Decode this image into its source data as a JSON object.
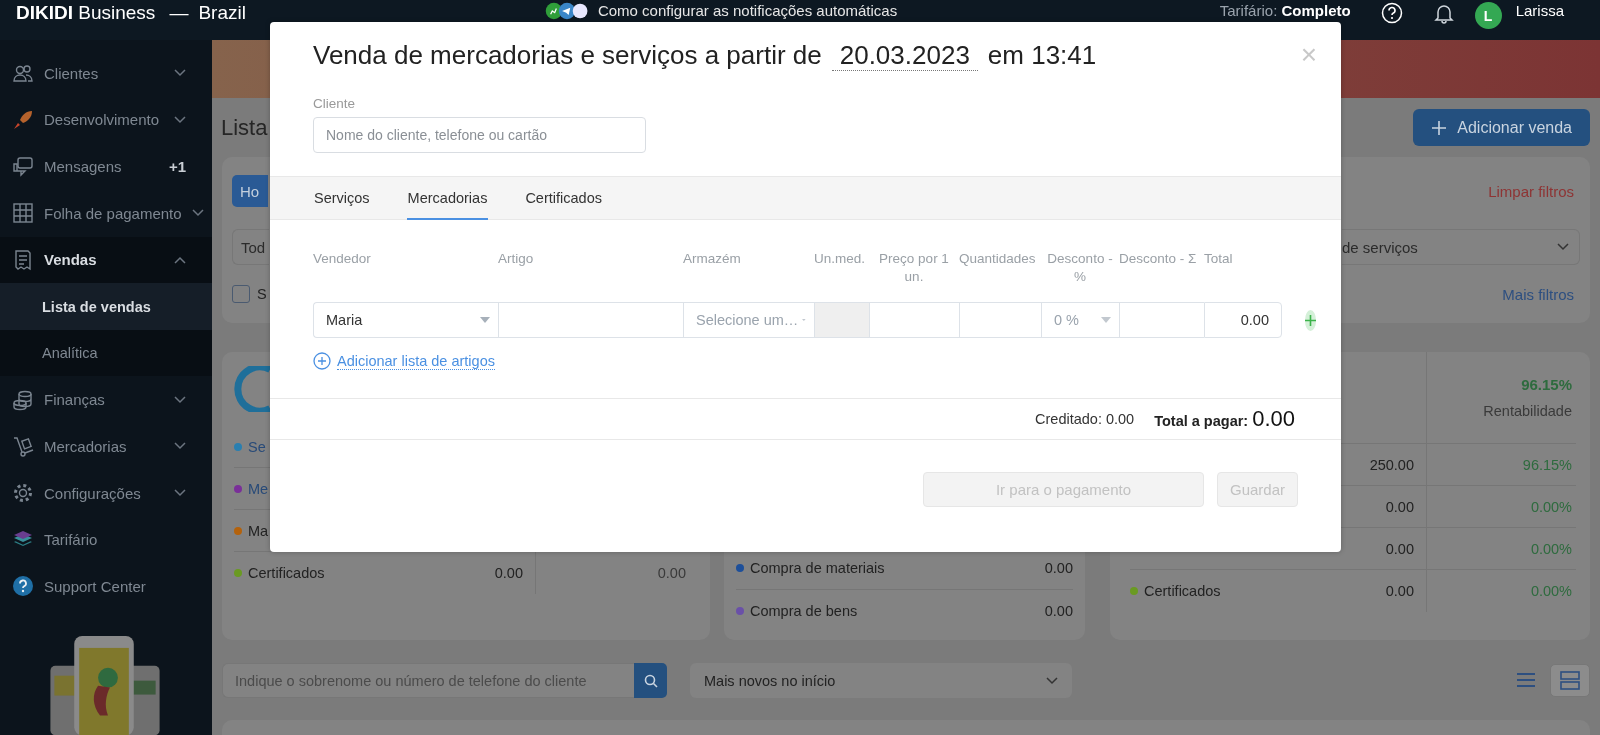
{
  "top_bar": {
    "brand": "**DIKIDI** Business",
    "separator": "—",
    "region": "Brazil",
    "notice": "Como configurar as notificações automáticas",
    "plan_label": "Tarifário:",
    "plan": "Completo",
    "user_initial": "L",
    "user_name": "Larissa"
  },
  "sidebar": {
    "items": [
      {
        "label": "Clientes",
        "expanded": false,
        "selected": false
      },
      {
        "label": "Desenvolvimento",
        "expanded": false,
        "selected": false
      },
      {
        "label": "Mensagens",
        "badge": "+1",
        "selected": false
      },
      {
        "label": "Folha de pagamento",
        "expanded": false,
        "selected": false
      },
      {
        "label": "Vendas",
        "expanded": true,
        "selected": true,
        "children": [
          {
            "label": "Lista de vendas",
            "selected": true
          },
          {
            "label": "Analítica",
            "selected": false
          }
        ]
      },
      {
        "label": "Finanças",
        "expanded": false,
        "selected": false
      },
      {
        "label": "Mercadorias",
        "expanded": false,
        "selected": false
      },
      {
        "label": "Configurações",
        "expanded": false,
        "selected": false
      },
      {
        "label": "Tarifário",
        "selected": false
      },
      {
        "label": "Support Center",
        "selected": false
      }
    ]
  },
  "main": {
    "title": "Lista",
    "add_button": "Adicionar venda",
    "filters": {
      "period_button": "Ho",
      "clear_link": "Limpar filtros",
      "select_left": "Tod",
      "select_right": "de serviços",
      "checkbox": {
        "label": "S",
        "checked": false
      },
      "more_link": "Mais filtros"
    },
    "summary_left": {
      "rows": [
        {
          "label": "Se",
          "color": "#2a7fb0",
          "kind": "link"
        },
        {
          "label": "Me",
          "color": "#7a2f99",
          "kind": "link"
        },
        {
          "label": "Ma",
          "color": "#b4620c",
          "kind": "text"
        },
        {
          "label": "Certificados",
          "color": "#6a9a22",
          "kind": "text",
          "value": "0.00",
          "value_2": "0.00"
        }
      ]
    },
    "summary_middle": {
      "rows": [
        {
          "label": "Compra de materiais",
          "color": "#1d4f9a",
          "value": "0.00"
        },
        {
          "label": "Compra de bens",
          "color": "#6a50a8",
          "value": "0.00"
        }
      ]
    },
    "summary_right": {
      "headline": "96.15%",
      "headline_label": "Rentabilidade",
      "rows": [
        {
          "value": "250.00",
          "percent": "96.15%"
        },
        {
          "value": "0.00",
          "percent": "0.00%"
        },
        {
          "value": "0.00",
          "percent": "0.00%"
        },
        {
          "label": "Certificados",
          "color": "#6a9a22",
          "value": "0.00",
          "percent": "0.00%"
        }
      ]
    },
    "search": {
      "placeholder": "Indique o sobrenome ou número de telefone do cliente"
    },
    "sort_select": "Mais novos no início",
    "views": [
      {
        "selected": false
      },
      {
        "selected": true
      }
    ]
  },
  "modal": {
    "title": "Venda de mercadorias e serviços a partir de",
    "date": "20.03.2023",
    "time": "em 13:41",
    "close": "×",
    "client_label": "Cliente",
    "client_placeholder": "Nome do cliente, telefone ou cartão",
    "tabs": [
      {
        "label": "Serviços",
        "selected": false
      },
      {
        "label": "Mercadorias",
        "selected": true
      },
      {
        "label": "Certificados",
        "selected": false
      }
    ],
    "columns": [
      "Vendedor",
      "Artigo",
      "Armazém",
      "Un.med.",
      "Preço por 1 un.",
      "Quantidades",
      "Desconto - %",
      "Desconto - Σ",
      "Total"
    ],
    "row": [
      {
        "kind": "select",
        "value": "Maria"
      },
      {
        "kind": "input"
      },
      {
        "kind": "select",
        "placeholder": "Selecione um…"
      },
      {
        "kind": "disabled"
      },
      {
        "kind": "input"
      },
      {
        "kind": "input"
      },
      {
        "kind": "select",
        "placeholder": "0 %"
      },
      {
        "kind": "input"
      },
      {
        "kind": "total",
        "value": "0.00"
      }
    ],
    "add_list_link": "Adicionar lista de artigos",
    "credited": "Creditado: 0.00",
    "total_label": "Total a pagar:",
    "total_value": "0.00",
    "buttons": [
      {
        "label": "Ir para o pagamento",
        "disabled": true
      },
      {
        "label": "Guardar",
        "disabled": true
      }
    ]
  }
}
